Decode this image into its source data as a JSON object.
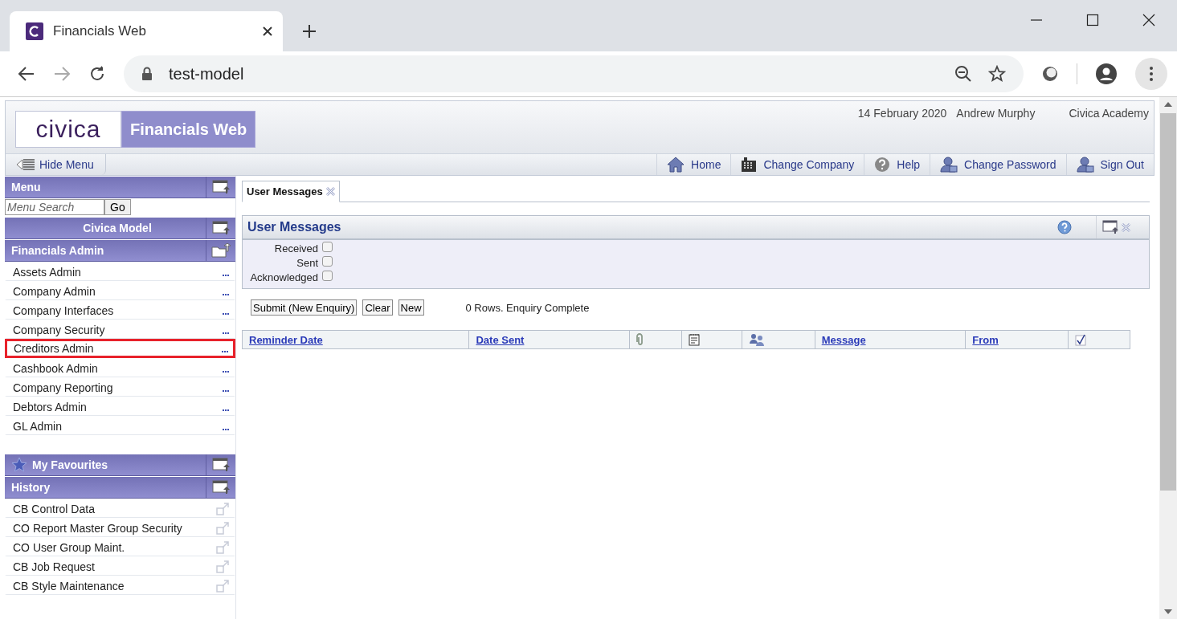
{
  "browser": {
    "tab_title": "Financials Web",
    "url": "test-model"
  },
  "header": {
    "logo": "civica",
    "product": "Financials Web",
    "date": "14 February 2020",
    "user": "Andrew Murphy",
    "company": "Civica Academy"
  },
  "toolbar": {
    "hide_menu": "Hide Menu",
    "links": [
      {
        "label": "Home",
        "kind": "home"
      },
      {
        "label": "Change Company",
        "kind": "building"
      },
      {
        "label": "Help",
        "kind": "help"
      },
      {
        "label": "Change Password",
        "kind": "user"
      },
      {
        "label": "Sign Out",
        "kind": "user"
      }
    ]
  },
  "sidebar": {
    "menu_title": "Menu",
    "search": {
      "placeholder": "Menu Search",
      "button": "Go"
    },
    "company": "Civica Model",
    "section": "Financials Admin",
    "items": [
      {
        "label": "Assets Admin",
        "highlighted": false
      },
      {
        "label": "Company Admin",
        "highlighted": false
      },
      {
        "label": "Company Interfaces",
        "highlighted": false
      },
      {
        "label": "Company Security",
        "highlighted": false
      },
      {
        "label": "Creditors Admin",
        "highlighted": true
      },
      {
        "label": "Cashbook Admin",
        "highlighted": false
      },
      {
        "label": "Company Reporting",
        "highlighted": false
      },
      {
        "label": "Debtors Admin",
        "highlighted": false
      },
      {
        "label": "GL Admin",
        "highlighted": false
      }
    ],
    "favourites": "My Favourites",
    "history_title": "History",
    "history": [
      "CB Control Data",
      "CO Report Master Group Security",
      "CO User Group Maint.",
      "CB Job Request",
      "CB Style Maintenance"
    ]
  },
  "content": {
    "tab": "User Messages",
    "panel_title": "User Messages",
    "filters": [
      {
        "label": "Received",
        "checked": false
      },
      {
        "label": "Sent",
        "checked": false
      },
      {
        "label": "Acknowledged",
        "checked": false
      }
    ],
    "buttons": [
      "Submit (New Enquiry)",
      "Clear",
      "New"
    ],
    "status": "0 Rows. Enquiry Complete",
    "columns": [
      {
        "kind": "text",
        "label": "Reminder Date"
      },
      {
        "kind": "text",
        "label": "Date Sent"
      },
      {
        "kind": "attachment"
      },
      {
        "kind": "note"
      },
      {
        "kind": "people"
      },
      {
        "kind": "text",
        "label": "Message"
      },
      {
        "kind": "text",
        "label": "From"
      },
      {
        "kind": "check"
      }
    ]
  }
}
